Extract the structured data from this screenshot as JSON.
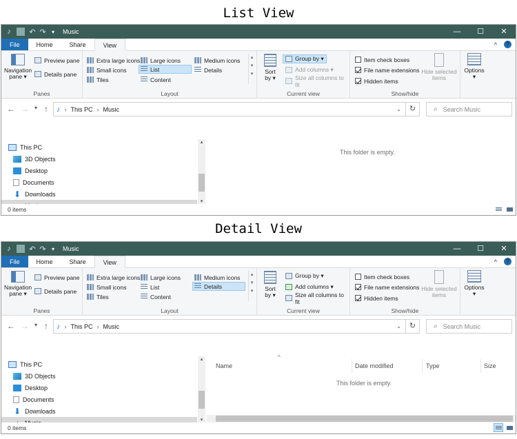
{
  "captions": {
    "top": "List View",
    "bottom": "Detail View"
  },
  "colors": {
    "titlebar": "#3b5d57",
    "file_tab": "#1f6fb5",
    "selection": "#cce4f7",
    "nav_selection": "#d9d9d9"
  },
  "window": {
    "title": "Music",
    "controls": {
      "minimize": "—",
      "maximize": "☐",
      "close": "✕"
    },
    "quick_access": {
      "undo": "↶",
      "redo": "↷",
      "dropdown": "▾"
    },
    "tabs": {
      "file": "File",
      "home": "Home",
      "share": "Share",
      "view": "View"
    },
    "ribbon_collapse": "^",
    "help": "?"
  },
  "ribbon": {
    "panes": {
      "navigation_pane": "Navigation",
      "navigation_pane_2": "pane ▾",
      "preview_pane": "Preview pane",
      "details_pane": "Details pane",
      "label": "Panes"
    },
    "layout": {
      "extra_large_icons": "Extra large icons",
      "large_icons": "Large icons",
      "medium_icons": "Medium icons",
      "small_icons": "Small icons",
      "list": "List",
      "details": "Details",
      "tiles": "Tiles",
      "content": "Content",
      "label": "Layout",
      "scroll_up": "▴",
      "scroll_down": "▾",
      "more": "▾"
    },
    "current_view": {
      "sort_by": "Sort",
      "sort_by_2": "by ▾",
      "group_by": "Group by ▾",
      "add_columns": "Add columns ▾",
      "size_all_columns": "Size all columns to fit",
      "label": "Current view"
    },
    "show_hide": {
      "item_check_boxes": "Item check boxes",
      "file_name_extensions": "File name extensions",
      "hidden_items": "Hidden items",
      "hide_selected": "Hide selected",
      "hide_selected_2": "items",
      "options": "Options",
      "options_2": "▾",
      "label": "Show/hide"
    }
  },
  "address": {
    "back": "←",
    "forward": "→",
    "recent": "▾",
    "up": "↑",
    "path": [
      "This PC",
      "Music"
    ],
    "path_sep": "›",
    "dropdown": "⌄",
    "refresh": "↻",
    "search_placeholder": "Search Music",
    "search_icon": "⌕"
  },
  "nav_pane": {
    "items": [
      {
        "label": "This PC"
      },
      {
        "label": "3D Objects"
      },
      {
        "label": "Desktop"
      },
      {
        "label": "Documents"
      },
      {
        "label": "Downloads"
      },
      {
        "label": "Music"
      }
    ],
    "scroll_up": "▴",
    "scroll_down": "▾"
  },
  "content": {
    "empty_message": "This folder is empty.",
    "columns": {
      "name": "Name",
      "date_modified": "Date modified",
      "type": "Type",
      "size": "Size"
    },
    "sort_indicator": "^"
  },
  "status": {
    "item_count": "0 items"
  }
}
